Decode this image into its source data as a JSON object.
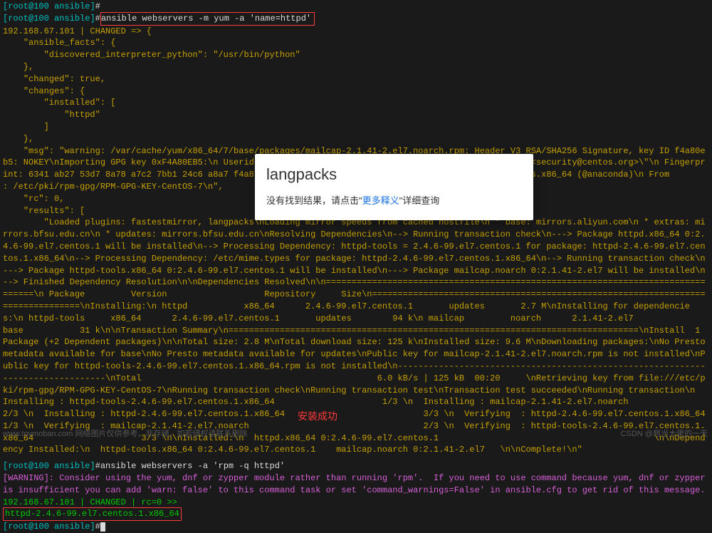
{
  "prompt": {
    "user": "root",
    "host": "100",
    "cwd": "ansible",
    "glyph": "#"
  },
  "cmd1": "ansible webservers -m yum -a 'name=httpd'",
  "cmd2": "ansible webservers -a 'rpm -q httpd'",
  "out": {
    "l1": "192.168.67.101 | CHANGED => {",
    "l2": "    \"ansible_facts\": {",
    "l3": "        \"discovered_interpreter_python\": \"/usr/bin/python\"",
    "l4": "    },",
    "l5": "    \"changed\": true,",
    "l6": "    \"changes\": {",
    "l7": "        \"installed\": [",
    "l8": "            \"httpd\"",
    "l9": "        ]",
    "l10": "    },",
    "msg_a": "    \"msg\": \"warning: /var/cache/yum/x86_64/7/base/packages/mailcap-2.1.41-2.el7.noarch.rpm: Header V3 RSA/SHA256 Signature, key ID f4a80eb5: NOKEY\\nImporting GPG key 0xF4A80EB5:\\n Userid     : \\\"CentOS-7 Key (CentOS 7 Official Signing Key) <security@centos.org>\\\"\\n Fingerprint: 6341 ab27 53d7 8a78 a7c2 7bb1 24c6 a8a7 f4a8 0eb5\\n Package    : centos-release-7-4.1708.el7.centos.x86_64 (@anaconda)\\n From       : /etc/pki/rpm-gpg/RPM-GPG-KEY-CentOS-7\\n\",",
    "l11": "    \"rc\": 0,",
    "l12": "    \"results\": [",
    "res_a": "        \"Loaded plugins: fastestmirror, langpacks\\nLoading mirror speeds from cached hostfile\\n * base: mirrors.aliyun.com\\n * extras: mirrors.bfsu.edu.cn\\n * updates: mirrors.bfsu.edu.cn\\nResolving Dependencies\\n--> Running transaction check\\n---> Package httpd.x86_64 0:2.4.6-99.el7.centos.1 will be installed\\n--> Processing Dependency: httpd-tools = 2.4.6-99.el7.centos.1 for package: httpd-2.4.6-99.el7.centos.1.x86_64\\n--> Processing Dependency: /etc/mime.types for package: httpd-2.4.6-99.el7.centos.1.x86_64\\n--> Running transaction check\\n---> Package httpd-tools.x86_64 0:2.4.6-99.el7.centos.1 will be installed\\n---> Package mailcap.noarch 0:2.1.41-2.el7 will be installed\\n--> Finished Dependency Resolution\\n\\nDependencies Resolved\\n\\n================================================================================\\n Package         Version                   Repository     Size\\n================================================================================\\nInstalling:\\n httpd           x86_64      2.4.6-99.el7.centos.1       updates       2.7 M\\nInstalling for dependencies:\\n httpd-tools     x86_64      2.4.6-99.el7.centos.1       updates        94 k\\n mailcap         noarch      2.1.41-2.el7               base           31 k\\n\\nTransaction Summary\\n================================================================================\\nInstall  1 Package (+2 Dependent packages)\\n\\nTotal size: 2.8 M\\nTotal download size: 125 k\\nInstalled size: 9.6 M\\nDownloading packages:\\nNo Presto metadata available for base\\nNo Presto metadata available for updates\\nPublic key for mailcap-2.1.41-2.el7.noarch.rpm is not installed\\nPublic key for httpd-tools-2.4.6-99.el7.centos.1.x86_64.rpm is not installed\\n--------------------------------------------------------------------------------\\nTotal                                              6.0 kB/s | 125 kB  00:20     \\nRetrieving key from file:///etc/pki/rpm-gpg/RPM-GPG-KEY-CentOS-7\\nRunning transaction check\\nRunning transaction test\\nTransaction test succeeded\\nRunning transaction\\n  Installing : httpd-tools-2.4.6-99.el7.centos.1.x86_64                     1/3 \\n  Installing : mailcap-2.1.41-2.el7.noarch                                  2/3 \\n  Installing : httpd-2.4.6-99.el7.centos.1.x86_64                           3/3 \\n  Verifying  : httpd-2.4.6-99.el7.centos.1.x86_64                           1/3 \\n  Verifying  : mailcap-2.1.41-2.el7.noarch                                  2/3 \\n  Verifying  : httpd-tools-2.4.6-99.el7.centos.1.x86_64                     3/3 \\n\\nInstalled:\\n  httpd.x86_64 0:2.4.6-99.el7.centos.1                                          \\n\\nDependency Installed:\\n  httpd-tools.x86_64 0:2.4.6-99.el7.centos.1    mailcap.noarch 0:2.1.41-2.el7   \\n\\nComplete!\\n\""
  },
  "warn": "[WARNING]: Consider using the yum, dnf or zypper module rather than running 'rpm'.  If you need to use command because yum, dnf or zypper is insufficient you can add 'warn: false' to this command task or set 'command_warnings=False' in ansible.cfg to get rid of this message.",
  "out2": {
    "l1": "192.168.67.101 | CHANGED | rc=0 >>",
    "l2": "httpd-2.4.6-99.el7.centos.1.x86_64"
  },
  "tooltip": {
    "title": "langpacks",
    "body_a": "没有找到结果，请点击\"",
    "link": "更多释义",
    "body_b": "\"详细查询"
  },
  "annotation": "安装成功",
  "footer": {
    "left": "www.toymoban.com 网络图片仅供参考，非存储，如若侵权请联系删除",
    "right": "CSDN @想当大佬的一天"
  }
}
